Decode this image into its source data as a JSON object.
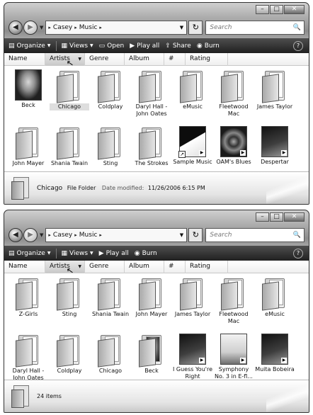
{
  "caption": {
    "minimize": "–",
    "maximize": "□",
    "close": "✕"
  },
  "icons": {
    "back": "◀",
    "forward": "▶",
    "nav_dropdown": "▼",
    "refresh": "↻",
    "search": "🔍",
    "help": "?",
    "play": "▶",
    "shortcut": "↗",
    "cursor": "↖"
  },
  "windows": [
    {
      "address": {
        "crumbs": [
          "Casey",
          "Music"
        ]
      },
      "search_placeholder": "Search",
      "toolbar": [
        {
          "icon": "▤",
          "label": "Organize",
          "dropdown": true
        },
        {
          "icon": "▦",
          "label": "Views",
          "dropdown": true
        },
        {
          "icon": "▭",
          "label": "Open",
          "dropdown": false
        },
        {
          "icon": "▶",
          "label": "Play all",
          "dropdown": false
        },
        {
          "icon": "⇪",
          "label": "Share",
          "dropdown": false
        },
        {
          "icon": "◉",
          "label": "Burn",
          "dropdown": false
        }
      ],
      "columns": [
        "Name",
        "Artists",
        "Genre",
        "Album",
        "#",
        "Rating"
      ],
      "items": [
        {
          "label": "Beck",
          "kind": "art-face"
        },
        {
          "label": "Chicago",
          "kind": "folder",
          "selected": true
        },
        {
          "label": "Coldplay",
          "kind": "folder"
        },
        {
          "label": "Daryl Hall - John Oates",
          "kind": "folder"
        },
        {
          "label": "eMusic",
          "kind": "folder"
        },
        {
          "label": "Fleetwood Mac",
          "kind": "folder"
        },
        {
          "label": "James Taylor",
          "kind": "folder"
        },
        {
          "label": "John Mayer",
          "kind": "folder"
        },
        {
          "label": "Shania Twain",
          "kind": "folder"
        },
        {
          "label": "Sting",
          "kind": "folder"
        },
        {
          "label": "The Strokes",
          "kind": "folder"
        },
        {
          "label": "Sample Music",
          "kind": "art-book"
        },
        {
          "label": "OAM's Blues",
          "kind": "art-spiral"
        },
        {
          "label": "Despertar",
          "kind": "art-dark"
        }
      ],
      "details": {
        "name": "Chicago",
        "type": "File Folder",
        "key": "Date modified:",
        "value": "11/26/2006 6:15 PM"
      }
    },
    {
      "address": {
        "crumbs": [
          "Casey",
          "Music"
        ]
      },
      "search_placeholder": "Search",
      "toolbar": [
        {
          "icon": "▤",
          "label": "Organize",
          "dropdown": true
        },
        {
          "icon": "▦",
          "label": "Views",
          "dropdown": true
        },
        {
          "icon": "▶",
          "label": "Play all",
          "dropdown": false
        },
        {
          "icon": "◉",
          "label": "Burn",
          "dropdown": false
        }
      ],
      "columns": [
        "Name",
        "Artists",
        "Genre",
        "Album",
        "#",
        "Rating"
      ],
      "items": [
        {
          "label": "Z-Girls",
          "kind": "folder"
        },
        {
          "label": "Sting",
          "kind": "folder"
        },
        {
          "label": "Shania Twain",
          "kind": "folder"
        },
        {
          "label": "John Mayer",
          "kind": "folder"
        },
        {
          "label": "James Taylor",
          "kind": "folder"
        },
        {
          "label": "Fleetwood Mac",
          "kind": "folder"
        },
        {
          "label": "eMusic",
          "kind": "folder"
        },
        {
          "label": "Daryl Hall - John Oates",
          "kind": "folder"
        },
        {
          "label": "Coldplay",
          "kind": "folder"
        },
        {
          "label": "Chicago",
          "kind": "folder"
        },
        {
          "label": "Beck",
          "kind": "folder-face"
        },
        {
          "label": "I Guess You're Right",
          "kind": "art-dark"
        },
        {
          "label": "Symphony No. 3 in E-fl...",
          "kind": "art-light"
        },
        {
          "label": "Muita Bobeira",
          "kind": "art-dark"
        }
      ],
      "details": {
        "count": "24 items"
      }
    }
  ]
}
